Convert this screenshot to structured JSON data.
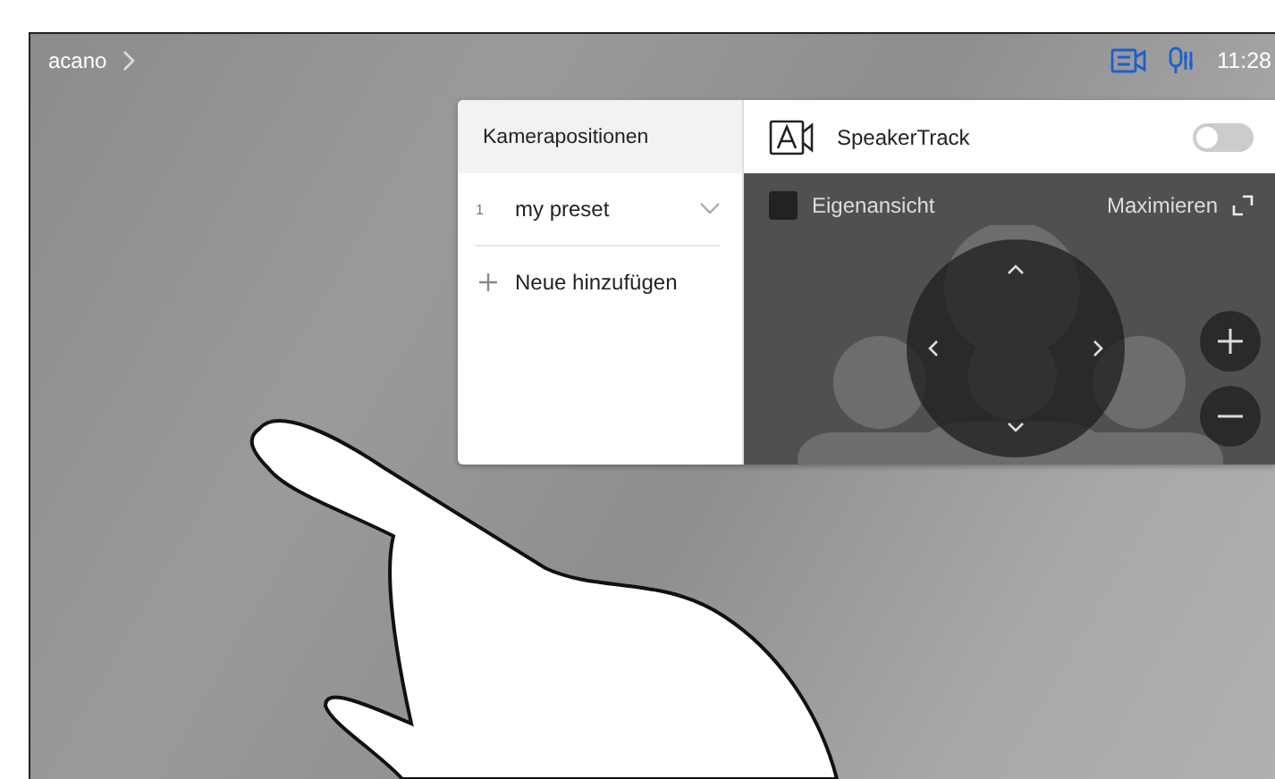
{
  "top_bar": {
    "breadcrumb": "acano",
    "time": "11:28"
  },
  "camera_panel": {
    "title": "Kamerapositionen",
    "presets": [
      {
        "number": "1",
        "name": "my preset"
      }
    ],
    "add_label": "Neue hinzufügen"
  },
  "speakertrack": {
    "label": "SpeakerTrack",
    "on": false
  },
  "preview": {
    "selfview_checked": false,
    "selfview_label": "Eigenansicht",
    "maximize_label": "Maximieren"
  }
}
